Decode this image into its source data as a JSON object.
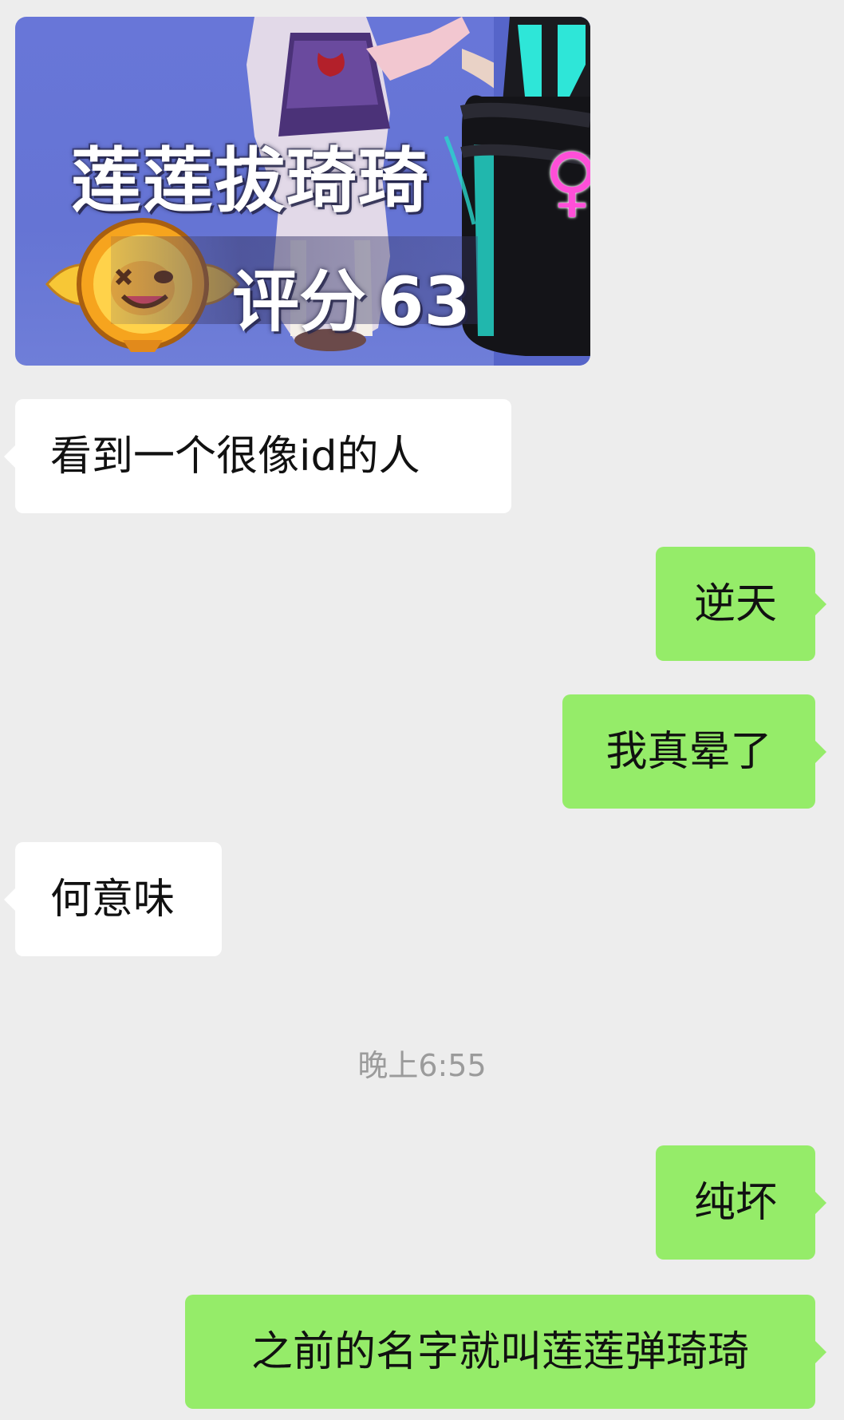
{
  "image_message": {
    "caption": "莲莲拔琦琦",
    "score_label": "评分",
    "score_value": "63",
    "gender_symbol": "♀"
  },
  "messages": [
    {
      "side": "left",
      "text": "看到一个很像id的人"
    },
    {
      "side": "right",
      "text": "逆天"
    },
    {
      "side": "right",
      "text": "我真晕了"
    },
    {
      "side": "left",
      "text": "何意味"
    },
    {
      "side": "right",
      "text": "纯坏"
    },
    {
      "side": "right",
      "text": "之前的名字就叫莲莲弹琦琦"
    }
  ],
  "timestamp": "晚上6:55",
  "colors": {
    "background": "#ededed",
    "incoming_bubble": "#ffffff",
    "outgoing_bubble": "#95ec69",
    "timestamp_text": "#9b9b9b",
    "image_background": "#6876d8",
    "gender_symbol": "#ff4fd8"
  }
}
